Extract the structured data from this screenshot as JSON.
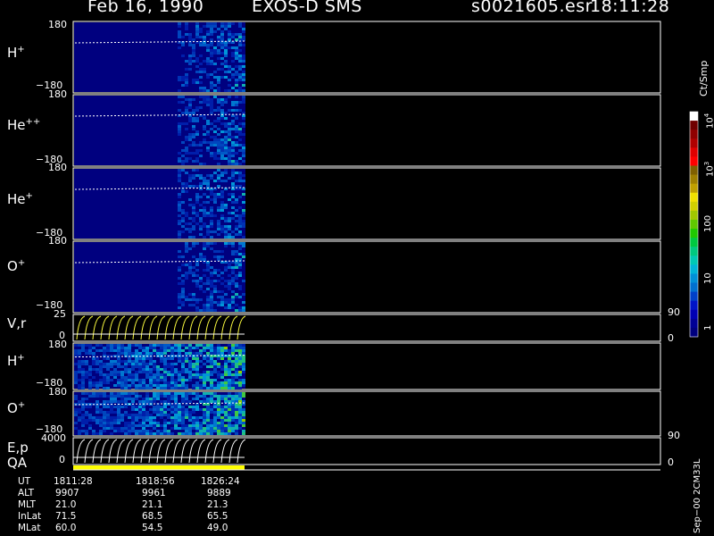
{
  "header": {
    "date": "Feb 16, 1990",
    "instrument": "EXOS-D SMS",
    "file": "s0021605.esr",
    "time": "18:11:28"
  },
  "panels": [
    {
      "label": "H",
      "sup": "+",
      "ytop": "180",
      "ybottom": "−180"
    },
    {
      "label": "He",
      "sup": "++",
      "ytop": "180",
      "ybottom": "−180"
    },
    {
      "label": "He",
      "sup": "+",
      "ytop": "180",
      "ybottom": "−180"
    },
    {
      "label": "O",
      "sup": "+",
      "ytop": "180",
      "ybottom": "−180"
    },
    {
      "label": "V,r",
      "sup": "",
      "ytop": "25",
      "ybottom": "0",
      "rtop": "90",
      "rbottom": "0"
    },
    {
      "label": "H",
      "sup": "+",
      "ytop": "180",
      "ybottom": "−180"
    },
    {
      "label": "O",
      "sup": "+",
      "ytop": "180",
      "ybottom": "−180"
    },
    {
      "label": "E,p",
      "sup": "",
      "ytop": "4000",
      "ybottom": "0",
      "rtop": "90",
      "rbottom": "0"
    }
  ],
  "qa_label": "QA",
  "colorbar": {
    "title": "Ct/Smp",
    "ticks": [
      "1",
      "10",
      "100",
      "10",
      "10"
    ],
    "tick_sups": [
      "",
      "",
      "",
      "3",
      "4"
    ],
    "colors": [
      "#00007f",
      "#000096",
      "#0000b4",
      "#0014c8",
      "#0040c8",
      "#0070d0",
      "#0090d8",
      "#00b4d8",
      "#00c8b4",
      "#00c880",
      "#00c840",
      "#20c800",
      "#60c800",
      "#a0c800",
      "#d0d000",
      "#f0e000",
      "#c0a000",
      "#a08000",
      "#806000",
      "#ff0000",
      "#e00000",
      "#b00000",
      "#900000",
      "#700000",
      "#ffffff"
    ]
  },
  "footer_side_text": "Sep−00 2CM33L",
  "info_table": {
    "labels": [
      "UT",
      "ALT",
      "MLT",
      "InLat",
      "MLat"
    ],
    "columns": [
      [
        "1811:28",
        "9907",
        "21.0",
        "71.5",
        "60.0"
      ],
      [
        "1818:56",
        "9961",
        "21.1",
        "68.5",
        "54.5"
      ],
      [
        "1826:24",
        "9889",
        "21.3",
        "65.5",
        "49.0"
      ]
    ]
  }
}
